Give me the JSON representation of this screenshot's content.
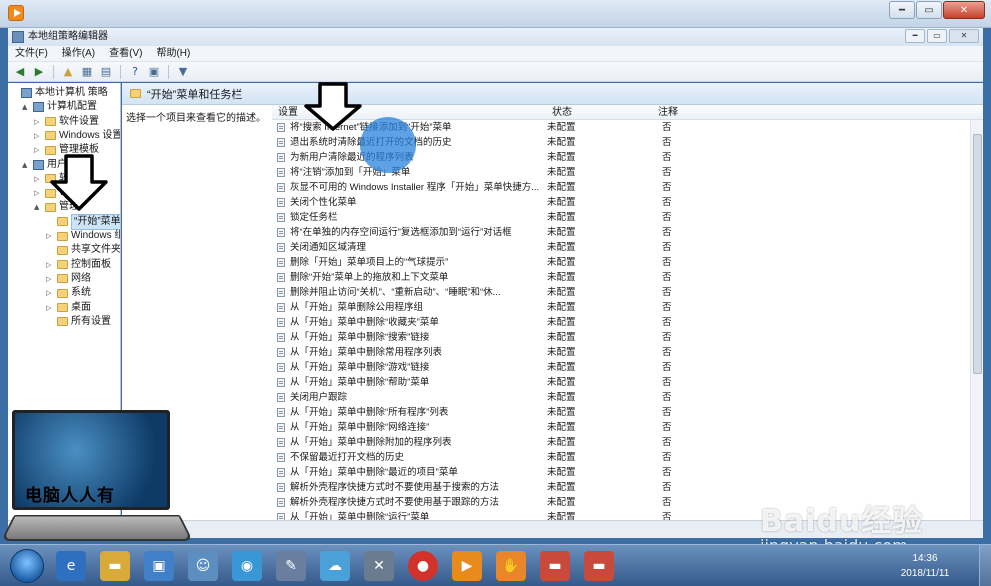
{
  "window": {
    "title": "本地组策略编辑器",
    "menu": [
      "文件(F)",
      "操作(A)",
      "查看(V)",
      "帮助(H)"
    ]
  },
  "tree": [
    {
      "label": "本地计算机 策略",
      "depth": 0,
      "icon": "node-icon",
      "toggle": ""
    },
    {
      "label": "计算机配置",
      "depth": 1,
      "icon": "node-icon",
      "toggle": "▲"
    },
    {
      "label": "软件设置",
      "depth": 2,
      "icon": "folder-icon",
      "toggle": "▷"
    },
    {
      "label": "Windows 设置",
      "depth": 2,
      "icon": "folder-icon",
      "toggle": "▷"
    },
    {
      "label": "管理模板",
      "depth": 2,
      "icon": "folder-icon",
      "toggle": "▷"
    },
    {
      "label": "用户",
      "depth": 1,
      "icon": "node-icon",
      "toggle": "▲"
    },
    {
      "label": "软",
      "depth": 2,
      "icon": "folder-icon",
      "toggle": "▷"
    },
    {
      "label": "W",
      "depth": 2,
      "icon": "folder-icon",
      "toggle": "▷"
    },
    {
      "label": "管理",
      "depth": 2,
      "icon": "folder-icon",
      "toggle": "▲"
    },
    {
      "label": "“开始”菜单",
      "depth": 3,
      "icon": "folder-icon",
      "toggle": "",
      "selected": true
    },
    {
      "label": "Windows 组",
      "depth": 3,
      "icon": "folder-icon",
      "toggle": "▷"
    },
    {
      "label": "共享文件夹",
      "depth": 3,
      "icon": "folder-icon",
      "toggle": ""
    },
    {
      "label": "控制面板",
      "depth": 3,
      "icon": "folder-icon",
      "toggle": "▷"
    },
    {
      "label": "网络",
      "depth": 3,
      "icon": "folder-icon",
      "toggle": "▷"
    },
    {
      "label": "系统",
      "depth": 3,
      "icon": "folder-icon",
      "toggle": "▷"
    },
    {
      "label": "桌面",
      "depth": 3,
      "icon": "folder-icon",
      "toggle": "▷"
    },
    {
      "label": "所有设置",
      "depth": 3,
      "icon": "folder-icon",
      "toggle": ""
    }
  ],
  "section": {
    "title": "“开始”菜单和任务栏",
    "description": "选择一个项目来查看它的描述。"
  },
  "columns": {
    "setting": "设置",
    "state": "状态",
    "note": "注释"
  },
  "rows": [
    {
      "setting": "将“搜索 Internet”链接添加到“开始”菜单",
      "state": "未配置",
      "note": "否"
    },
    {
      "setting": "退出系统时清除最近打开的文档的历史",
      "state": "未配置",
      "note": "否"
    },
    {
      "setting": "为新用户清除最近的程序列表",
      "state": "未配置",
      "note": "否"
    },
    {
      "setting": "将“注销”添加到「开始」菜单",
      "state": "未配置",
      "note": "否"
    },
    {
      "setting": "灰显不可用的 Windows Installer 程序「开始」菜单快捷方...",
      "state": "未配置",
      "note": "否"
    },
    {
      "setting": "关闭个性化菜单",
      "state": "未配置",
      "note": "否"
    },
    {
      "setting": "锁定任务栏",
      "state": "未配置",
      "note": "否"
    },
    {
      "setting": "将“在单独的内存空间运行”复选框添加到“运行”对话框",
      "state": "未配置",
      "note": "否"
    },
    {
      "setting": "关闭通知区域清理",
      "state": "未配置",
      "note": "否"
    },
    {
      "setting": "删除「开始」菜单项目上的“气球提示”",
      "state": "未配置",
      "note": "否"
    },
    {
      "setting": "删除“开始”菜单上的拖放和上下文菜单",
      "state": "未配置",
      "note": "否"
    },
    {
      "setting": "删除并阻止访问“关机”、“重新启动”、“睡眠”和“休...",
      "state": "未配置",
      "note": "否"
    },
    {
      "setting": "从「开始」菜单删除公用程序组",
      "state": "未配置",
      "note": "否"
    },
    {
      "setting": "从「开始」菜单中删除“收藏夹”菜单",
      "state": "未配置",
      "note": "否"
    },
    {
      "setting": "从「开始」菜单中删除“搜索”链接",
      "state": "未配置",
      "note": "否"
    },
    {
      "setting": "从「开始」菜单中删除常用程序列表",
      "state": "未配置",
      "note": "否"
    },
    {
      "setting": "从「开始」菜单中删除“游戏”链接",
      "state": "未配置",
      "note": "否"
    },
    {
      "setting": "从「开始」菜单中删除“帮助”菜单",
      "state": "未配置",
      "note": "否"
    },
    {
      "setting": "关闭用户跟踪",
      "state": "未配置",
      "note": "否"
    },
    {
      "setting": "从「开始」菜单中删除“所有程序”列表",
      "state": "未配置",
      "note": "否"
    },
    {
      "setting": "从「开始」菜单中删除“网络连接”",
      "state": "未配置",
      "note": "否"
    },
    {
      "setting": "从「开始」菜单中删除附加的程序列表",
      "state": "未配置",
      "note": "否"
    },
    {
      "setting": "不保留最近打开文档的历史",
      "state": "未配置",
      "note": "否"
    },
    {
      "setting": "从「开始」菜单中删除“最近的项目”菜单",
      "state": "未配置",
      "note": "否"
    },
    {
      "setting": "解析外壳程序快捷方式时不要使用基于搜索的方法",
      "state": "未配置",
      "note": "否"
    },
    {
      "setting": "解析外壳程序快捷方式时不要使用基于跟踪的方法",
      "state": "未配置",
      "note": "否"
    },
    {
      "setting": "从「开始」菜单中删除“运行”菜单",
      "state": "未配置",
      "note": "否"
    }
  ],
  "logo": {
    "text": "电脑人人有"
  },
  "watermark": {
    "brand": "Baidu经验",
    "url": "jingyan.baidu.com"
  },
  "taskbar": {
    "time": "14:36",
    "date": "2018/11/11"
  },
  "colors": {
    "selected": "#cde4f7",
    "taskbar": "#35598a",
    "highlight_circle": "#2882dc"
  }
}
